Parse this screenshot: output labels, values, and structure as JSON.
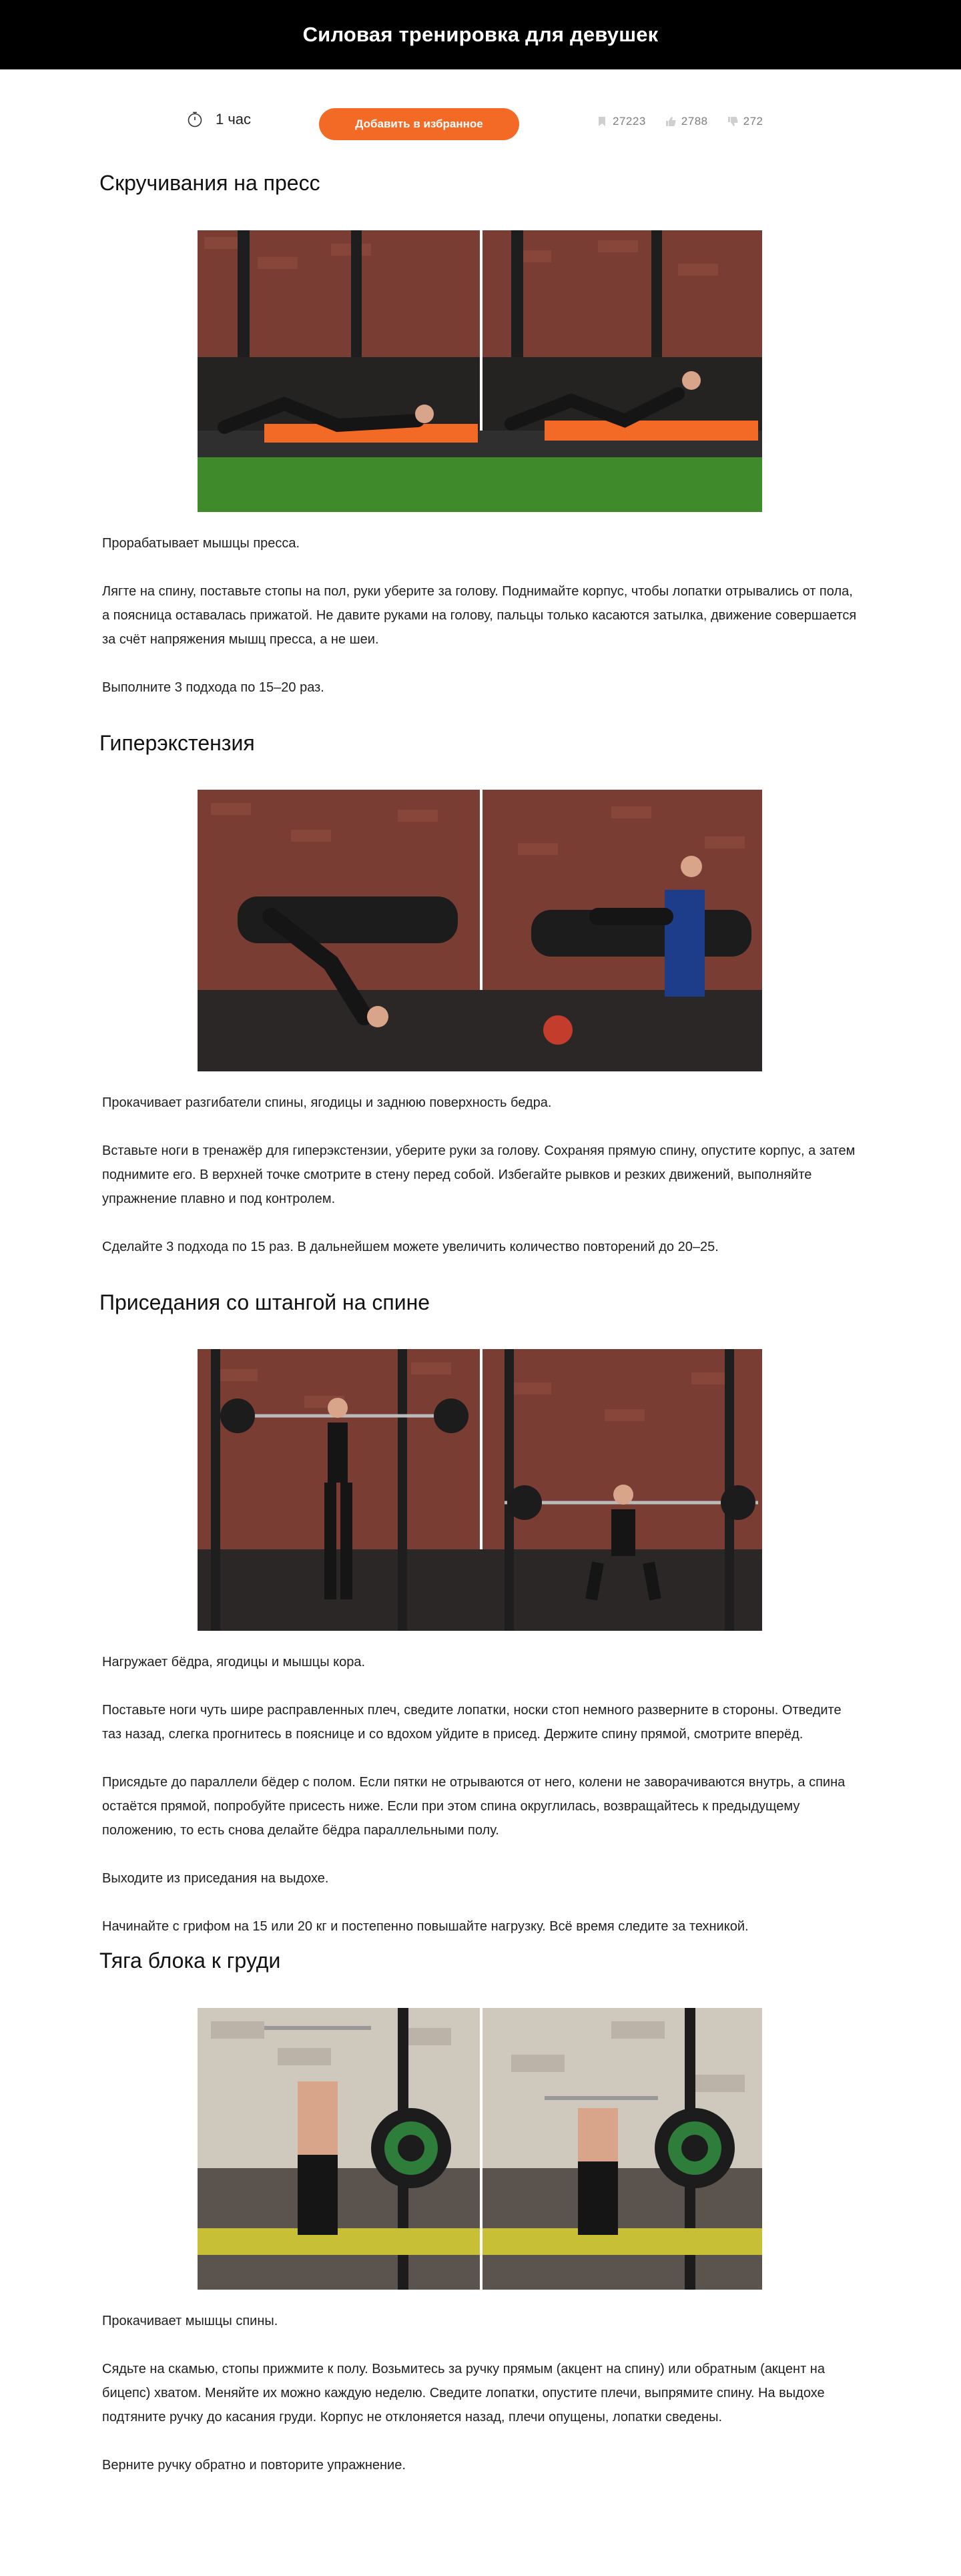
{
  "header": {
    "title": "Силовая тренировка для девушек"
  },
  "meta": {
    "duration": "1 час",
    "favorite_label": "Добавить в избранное",
    "views": "27223",
    "likes": "2788",
    "dislikes": "272"
  },
  "colors": {
    "accent": "#f26a25",
    "header_bg": "#000000",
    "muted": "#7d7d7d"
  },
  "exercises": [
    {
      "title": "Скручивания на пресс",
      "paragraphs": [
        "Прорабатывает мышцы пресса.",
        "Лягте на спину, поставьте стопы на пол, руки уберите за голову. Поднимайте корпус, чтобы лопатки отрывались от пола, а поясница оставалась прижатой. Не давите руками на голову, пальцы только касаются затылка, движение совершается за счёт напряжения мышц пресса, а не шеи.",
        "Выполните 3 подхода по 15–20 раз."
      ]
    },
    {
      "title": "Гиперэкстензия",
      "paragraphs": [
        "Прокачивает разгибатели спины, ягодицы и заднюю поверхность бедра.",
        "Вставьте ноги в тренажёр для гиперэкстензии, уберите руки за голову. Сохраняя прямую спину, опустите корпус, а затем поднимите его. В верхней точке смотрите в стену перед собой. Избегайте рывков и резких движений, выполняйте упражнение плавно и под контролем.",
        "Сделайте 3 подхода по 15 раз. В дальнейшем можете увеличить количество повторений до 20–25."
      ]
    },
    {
      "title": "Приседания со штангой на спине",
      "paragraphs": [
        "Нагружает бёдра, ягодицы и мышцы кора.",
        "Поставьте ноги чуть шире расправленных плеч, сведите лопатки, носки стоп немного разверните в стороны. Отведите таз назад, слегка прогнитесь в пояснице и со вдохом уйдите в присед. Держите спину прямой, смотрите вперёд.",
        "Присядьте до параллели бёдер с полом. Если пятки не отрываются от него, колени не заворачиваются внутрь, а спина остаётся прямой, попробуйте присесть ниже. Если при этом спина округлилась, возвращайтесь к предыдущему положению, то есть снова делайте бёдра параллельными полу.",
        "Выходите из приседания на выдохе.",
        "Начинайте с грифом на 15 или 20 кг и постепенно повышайте нагрузку. Всё время следите за техникой."
      ]
    },
    {
      "title": "Тяга блока к груди",
      "paragraphs": [
        "Прокачивает мышцы спины.",
        "Сядьте на скамью, стопы прижмите к полу. Возьмитесь за ручку прямым (акцент на спину) или обратным (акцент на бицепс) хватом. Меняйте их можно каждую неделю. Сведите лопатки, опустите плечи, выпрямите спину. На выдохе подтяните ручку до касания груди. Корпус не отклоняется назад, плечи опущены, лопатки сведены.",
        "Верните ручку обратно и повторите упражнение."
      ]
    }
  ]
}
